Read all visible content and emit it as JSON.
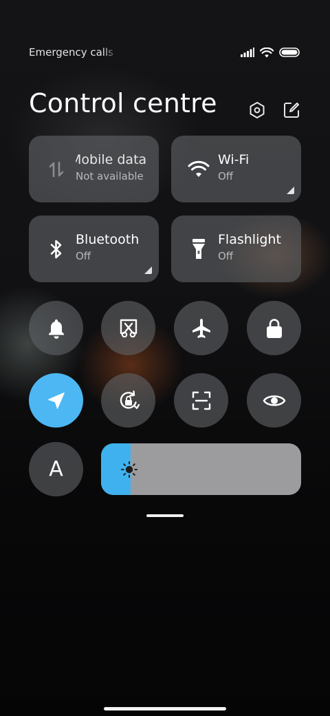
{
  "status_bar": {
    "carrier_text": "Emergency calls only",
    "icons": [
      "signal-icon",
      "wifi-icon",
      "battery-icon"
    ]
  },
  "header": {
    "title": "Control centre",
    "icons": [
      "settings-icon",
      "edit-icon"
    ]
  },
  "tiles": [
    {
      "name": "Mobile data",
      "status": "Not available",
      "icon": "mobile-data-icon",
      "enabled": false
    },
    {
      "name": "Wi-Fi",
      "status": "Off",
      "icon": "wifi-icon",
      "enabled": false
    },
    {
      "name": "Bluetooth",
      "status": "Off",
      "icon": "bluetooth-icon",
      "enabled": false
    },
    {
      "name": "Flashlight",
      "status": "Off",
      "icon": "flashlight-icon",
      "enabled": false
    }
  ],
  "round_toggles": [
    {
      "icon": "bell-icon",
      "active": false
    },
    {
      "icon": "screenshot-icon",
      "active": false
    },
    {
      "icon": "airplane-icon",
      "active": false
    },
    {
      "icon": "lock-icon",
      "active": false
    },
    {
      "icon": "location-icon",
      "active": true
    },
    {
      "icon": "rotation-lock-icon",
      "active": false
    },
    {
      "icon": "scan-icon",
      "active": false
    },
    {
      "icon": "eye-icon",
      "active": false
    }
  ],
  "auto_brightness": {
    "letter": "A",
    "icon": "auto-brightness-icon"
  },
  "brightness": {
    "level": 0.147,
    "icon": "sun-icon"
  },
  "colors": {
    "accent": "#4db7f3",
    "tile_bg": "#5f6266",
    "slider_track": "#9c9c9e",
    "slider_fill": "#3fb1ee"
  }
}
